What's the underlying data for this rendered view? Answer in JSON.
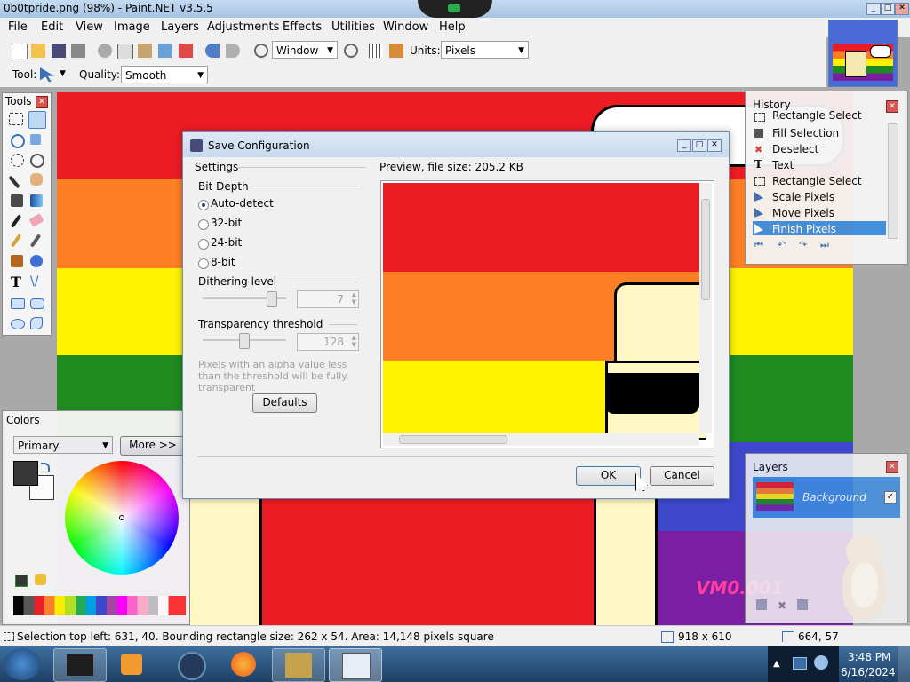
{
  "window": {
    "title": "0b0tpride.png (98%) - Paint.NET v3.5.5"
  },
  "menu": [
    "File",
    "Edit",
    "View",
    "Image",
    "Layers",
    "Adjustments",
    "Effects",
    "Utilities",
    "Window",
    "Help"
  ],
  "toolbar": {
    "zoom_combo": "Window",
    "units_label": "Units:",
    "units_value": "Pixels",
    "tool_label": "Tool:",
    "quality_label": "Quality:",
    "quality_value": "Smooth"
  },
  "tools_panel": {
    "title": "Tools"
  },
  "colors_panel": {
    "title": "Colors",
    "mode": "Primary",
    "more_label": "More >>"
  },
  "history_panel": {
    "title": "History",
    "items": [
      "Rectangle Select",
      "Fill Selection",
      "Deselect",
      "Text",
      "Rectangle Select",
      "Scale Pixels",
      "Move Pixels",
      "Finish Pixels"
    ],
    "selected_index": 7
  },
  "layers_panel": {
    "title": "Layers",
    "layer_name": "Background"
  },
  "dialog": {
    "title": "Save Configuration",
    "settings_label": "Settings",
    "preview_label": "Preview, file size: 205.2 KB",
    "bit_depth_label": "Bit Depth",
    "bit_options": [
      "Auto-detect",
      "32-bit",
      "24-bit",
      "8-bit"
    ],
    "bit_selected": 0,
    "dithering_label": "Dithering level",
    "dithering_value": "7",
    "dithering_level": 0.77,
    "transparency_label": "Transparency threshold",
    "transparency_value": "128",
    "transparency_level": 0.5,
    "hint": "Pixels with an alpha value less than the threshold will be fully transparent",
    "defaults_label": "Defaults",
    "ok_label": "OK",
    "cancel_label": "Cancel"
  },
  "status": {
    "selection": "Selection top left: 631, 40. Bounding rectangle size: 262 x 54. Area: 14,148 pixels square",
    "image_size": "918 x 610",
    "cursor": "664, 57"
  },
  "taskbar": {
    "time": "3:48 PM",
    "date": "6/16/2024"
  },
  "watermark": "VM0.001",
  "colors": {
    "red": "#ed1c24",
    "orange": "#ff7f27",
    "yellow": "#fff200",
    "green": "#1f8a1f",
    "blue": "#3f48cc",
    "purple": "#7a1fa2",
    "selection_blue": "#3d8ee0"
  }
}
